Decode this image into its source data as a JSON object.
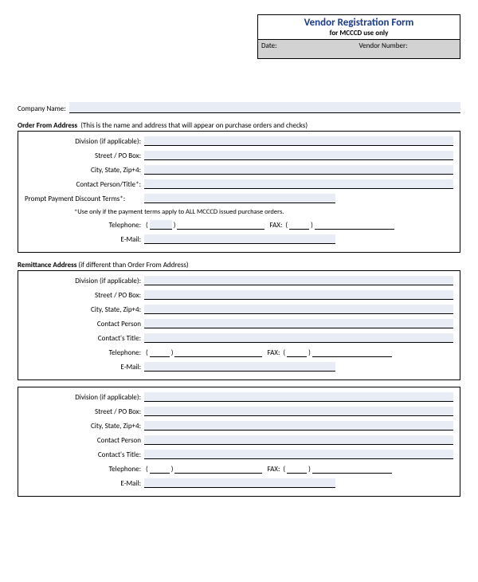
{
  "header": {
    "title": "Vendor Registration Form",
    "subtitle": "for MCCCD use only",
    "date_label": "Date:",
    "vendor_number_label": "Vendor Number:"
  },
  "company_name_label": "Company Name:",
  "order_from": {
    "title": "Order From Address",
    "note": "(This is the name and address that will appear on purchase orders and checks)",
    "division_label": "Division (if applicable):",
    "street_label": "Street / PO Box:",
    "city_label": "City, State, Zip+4:",
    "contact_label": "Contact Person/Title*:",
    "terms_label": "Prompt Payment Discount Terms*:",
    "terms_note": "*Use only if the payment terms apply to ALL MCCCD issued purchase orders.",
    "telephone_label": "Telephone:",
    "fax_label": "FAX:",
    "email_label": "E-Mail:"
  },
  "remit": {
    "title": "Remittance Address",
    "note": "(if different than Order From Address)",
    "division_label": "Division (if applicable):",
    "street_label": "Street / PO Box:",
    "city_label": "City, State, Zip+4:",
    "contact_person_label": "Contact Person",
    "contact_title_label": "Contact's Title:",
    "telephone_label": "Telephone:",
    "fax_label": "FAX:",
    "email_label": "E-Mail:"
  },
  "third": {
    "division_label": "Division (if applicable):",
    "street_label": "Street / PO Box:",
    "city_label": "City, State, Zip+4:",
    "contact_person_label": "Contact Person",
    "contact_title_label": "Contact's Title:",
    "telephone_label": "Telephone:",
    "fax_label": "FAX:",
    "email_label": "E-Mail:"
  }
}
